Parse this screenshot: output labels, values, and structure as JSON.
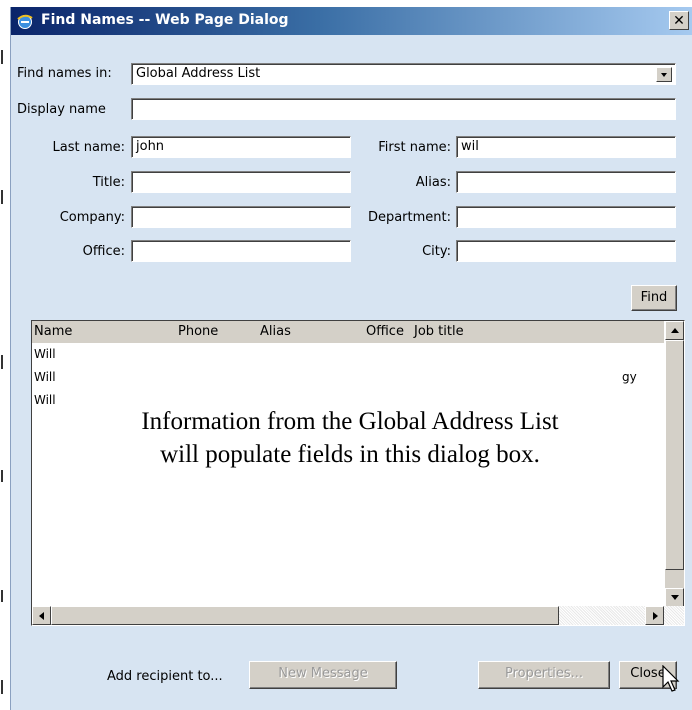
{
  "window": {
    "title": "Find Names -- Web Page Dialog",
    "close_glyph": "✕"
  },
  "form": {
    "find_in_label": "Find names in:",
    "find_in_value": "Global Address List",
    "display_name_label": "Display name",
    "display_name_value": "",
    "last_name_label": "Last name:",
    "last_name_value": "john",
    "first_name_label": "First name:",
    "first_name_value": "wil",
    "title_label": "Title:",
    "title_value": "",
    "alias_label": "Alias:",
    "alias_value": "",
    "company_label": "Company:",
    "company_value": "",
    "department_label": "Department:",
    "department_value": "",
    "office_label": "Office:",
    "office_value": "",
    "city_label": "City:",
    "city_value": "",
    "find_button": "Find"
  },
  "results": {
    "columns": [
      "Name",
      "Phone",
      "Alias",
      "Office",
      "Job title"
    ],
    "rows": [
      {
        "name": "Will",
        "extra": ""
      },
      {
        "name": "Will",
        "extra": "gy"
      },
      {
        "name": "Will",
        "extra": ""
      }
    ]
  },
  "overlay": {
    "line1": "Information from the Global Address List",
    "line2": "will populate fields in this dialog box."
  },
  "footer": {
    "add_recipient_label": "Add recipient to...",
    "new_message_button": "New Message",
    "properties_button": "Properties...",
    "close_button": "Close"
  }
}
